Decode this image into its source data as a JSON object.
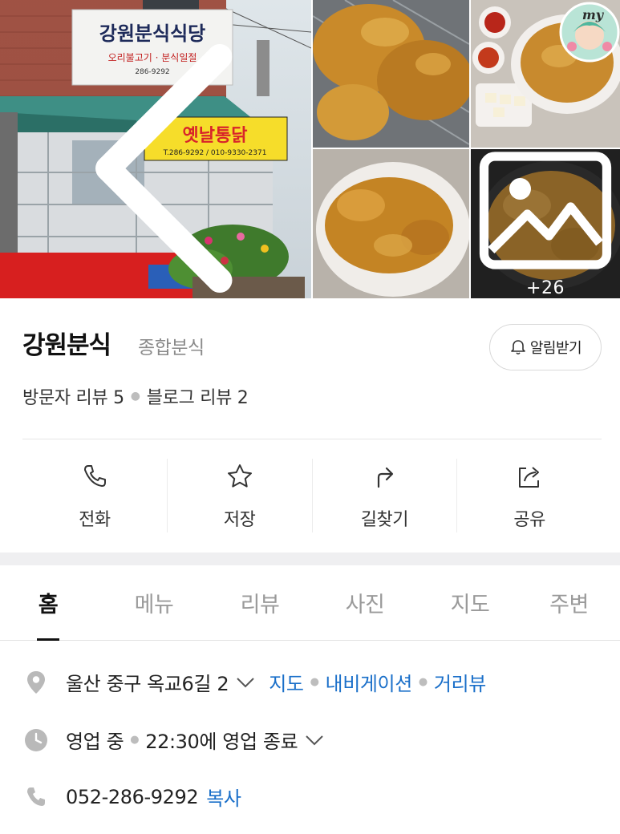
{
  "gallery": {
    "main_photo": {
      "sign_name": "강원분식식당",
      "sign_sub": "오리불고기 · 분식일절",
      "sign_phone": "286-9292",
      "banner_name": "옛날통닭",
      "banner_phone": "T.286-9292 / 010-9330-2371"
    },
    "more_count": "+26",
    "badge_text": "my"
  },
  "place": {
    "name": "강원분식",
    "category": "종합분식",
    "notify_label": "알림받기",
    "visitor_reviews": "방문자 리뷰 5",
    "blog_reviews": "블로그 리뷰 2"
  },
  "actions": [
    {
      "label": "전화",
      "icon": "phone-icon"
    },
    {
      "label": "저장",
      "icon": "star-icon"
    },
    {
      "label": "길찾기",
      "icon": "directions-icon"
    },
    {
      "label": "공유",
      "icon": "share-icon"
    }
  ],
  "tabs": [
    {
      "label": "홈",
      "active": true
    },
    {
      "label": "메뉴",
      "active": false
    },
    {
      "label": "리뷰",
      "active": false
    },
    {
      "label": "사진",
      "active": false
    },
    {
      "label": "지도",
      "active": false
    },
    {
      "label": "주변",
      "active": false
    }
  ],
  "info": {
    "address": "울산 중구 옥교6길 2",
    "address_links": [
      "지도",
      "내비게이션",
      "거리뷰"
    ],
    "status": "영업 중",
    "hours": "22:30에 영업 종료",
    "phone": "052-286-9292",
    "copy_label": "복사"
  },
  "colors": {
    "link": "#1a6fc9",
    "muted": "#9a9a9a",
    "banner_yellow": "#f6dd2a",
    "banner_red": "#d8242a"
  }
}
